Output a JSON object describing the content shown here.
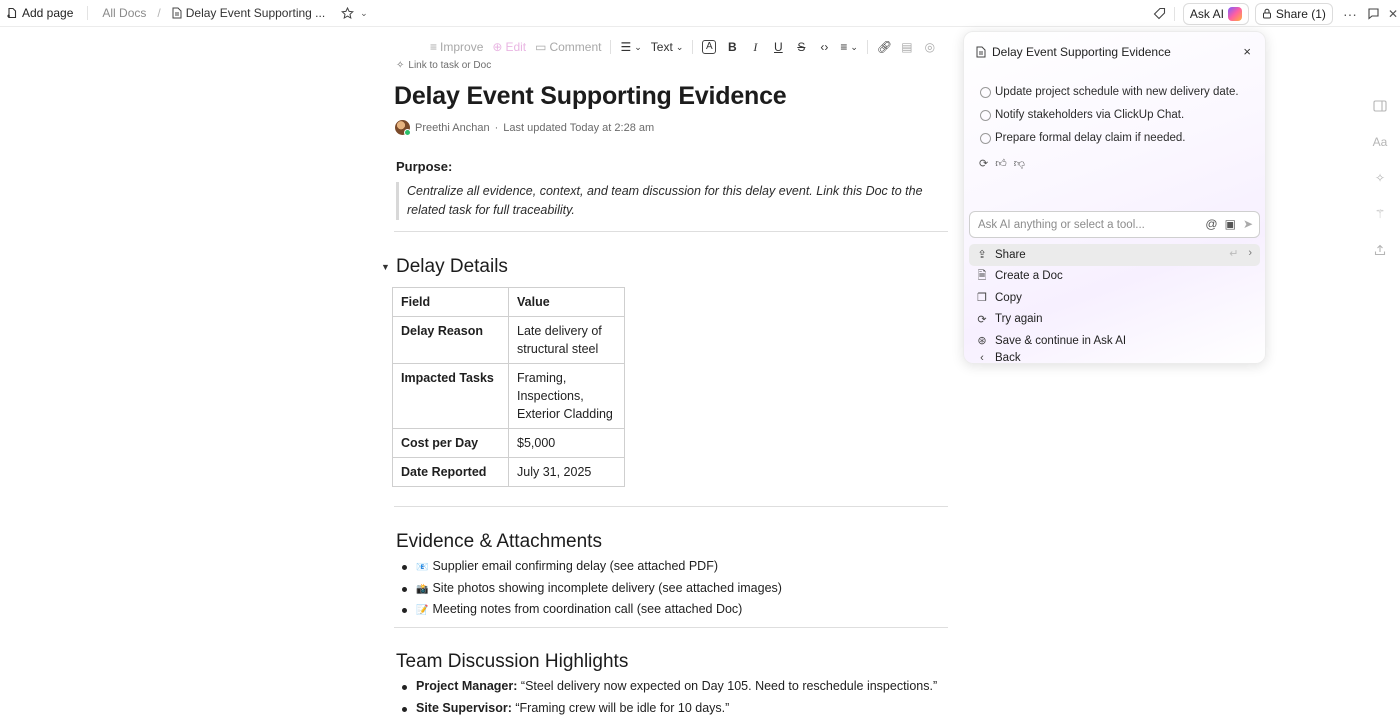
{
  "topbar": {
    "add_page": "Add page",
    "crumb_root": "All Docs",
    "crumb_sep": "/",
    "crumb_current": "Delay Event Supporting ...",
    "ask_ai": "Ask AI",
    "share": "Share (1)"
  },
  "toolbar": {
    "improve": "Improve",
    "edit": "Edit",
    "comment": "Comment",
    "text_style": "Text",
    "color_label": "A",
    "bold": "B",
    "italic": "I",
    "underline": "U",
    "strike": "S"
  },
  "doc": {
    "link_task": "Link to task or Doc",
    "title": "Delay Event Supporting Evidence",
    "author": "Preethi Anchan",
    "meta_sep": "·",
    "updated": "Last updated Today at 2:28 am",
    "purpose_label": "Purpose:",
    "purpose_text": "Centralize all evidence, context, and team discussion for this delay event. Link this Doc to the related task for full traceability.",
    "delay_heading": "Delay Details",
    "table": {
      "headers": [
        "Field",
        "Value"
      ],
      "rows": [
        {
          "field": "Delay Reason",
          "value_lines": [
            "Late delivery of",
            "structural steel"
          ]
        },
        {
          "field": "Impacted Tasks",
          "value_lines": [
            "Framing,",
            "Inspections,",
            "Exterior Cladding"
          ]
        },
        {
          "field": "Cost per Day",
          "value_lines": [
            "$5,000"
          ]
        },
        {
          "field": "Date Reported",
          "value_lines": [
            "July 31, 2025"
          ]
        }
      ]
    },
    "evidence_heading": "Evidence & Attachments",
    "evidence_items": [
      {
        "emoji": "📧",
        "text": "Supplier email confirming delay (see attached PDF)"
      },
      {
        "emoji": "📸",
        "text": "Site photos showing incomplete delivery (see attached images)"
      },
      {
        "emoji": "📝",
        "text": "Meeting notes from coordination call (see attached Doc)"
      }
    ],
    "discussion_heading": "Team Discussion Highlights",
    "discussion_items": [
      {
        "who": "Project Manager:",
        "quote": "“Steel delivery now expected on Day 105. Need to reschedule inspections.”"
      },
      {
        "who": "Site Supervisor:",
        "quote": "“Framing crew will be idle for 10 days.”"
      }
    ]
  },
  "ai_panel": {
    "title": "Delay Event Supporting Evidence",
    "close": "×",
    "suggestions": [
      "Update project schedule with new delivery date.",
      "Notify stakeholders via ClickUp Chat.",
      "Prepare formal delay claim if needed."
    ],
    "input_placeholder": "Ask AI anything or select a tool...",
    "menu": [
      {
        "label": "Share",
        "icon": "share-icon"
      },
      {
        "label": "Create a Doc",
        "icon": "doc-plus-icon"
      },
      {
        "label": "Copy",
        "icon": "copy-icon"
      },
      {
        "label": "Try again",
        "icon": "refresh-icon"
      },
      {
        "label": "Save & continue in Ask AI",
        "icon": "ai-save-icon"
      },
      {
        "label": "Back",
        "icon": "chevron-left-icon"
      }
    ]
  }
}
